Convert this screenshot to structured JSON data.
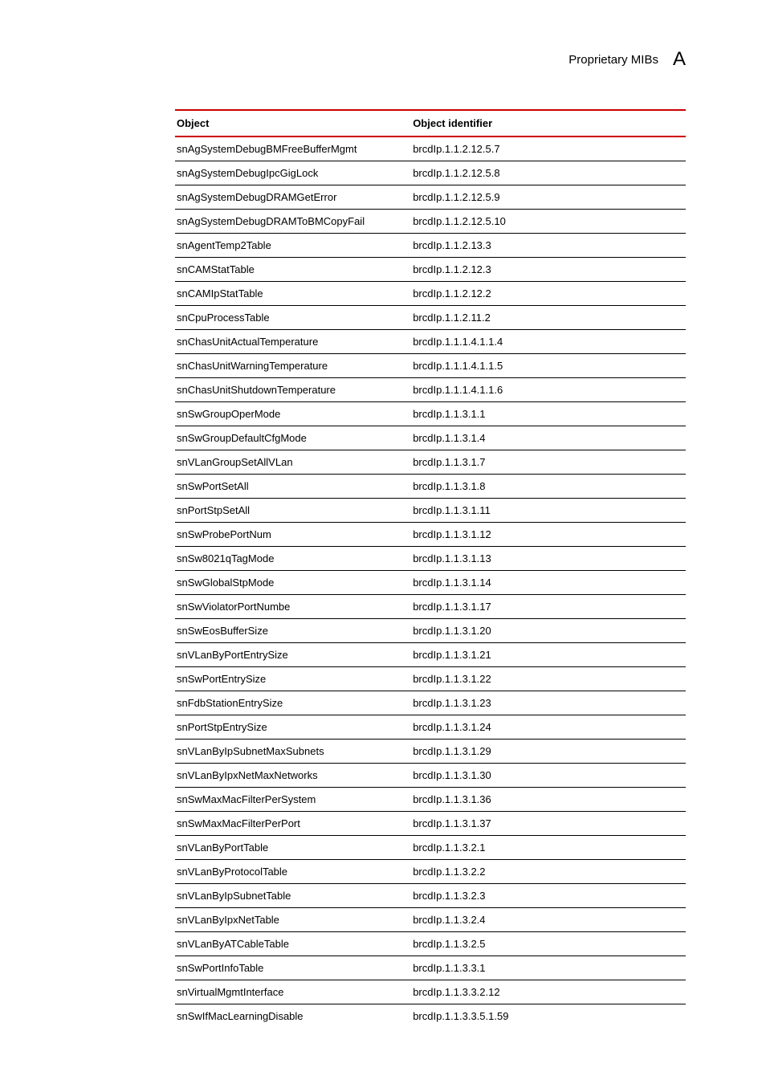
{
  "header": {
    "title": "Proprietary MIBs",
    "badge": "A"
  },
  "table": {
    "columns": [
      "Object",
      "Object identifier"
    ],
    "rows": [
      {
        "object": "snAgSystemDebugBMFreeBufferMgmt",
        "oid": "brcdIp.1.1.2.12.5.7"
      },
      {
        "object": "snAgSystemDebugIpcGigLock",
        "oid": "brcdIp.1.1.2.12.5.8"
      },
      {
        "object": "snAgSystemDebugDRAMGetError",
        "oid": "brcdIp.1.1.2.12.5.9"
      },
      {
        "object": "snAgSystemDebugDRAMToBMCopyFail",
        "oid": "brcdIp.1.1.2.12.5.10"
      },
      {
        "object": "snAgentTemp2Table",
        "oid": "brcdIp.1.1.2.13.3"
      },
      {
        "object": "snCAMStatTable",
        "oid": "brcdIp.1.1.2.12.3"
      },
      {
        "object": "snCAMIpStatTable",
        "oid": "brcdIp.1.1.2.12.2"
      },
      {
        "object": "snCpuProcessTable",
        "oid": "brcdIp.1.1.2.11.2"
      },
      {
        "object": "snChasUnitActualTemperature",
        "oid": "brcdIp.1.1.1.4.1.1.4"
      },
      {
        "object": "snChasUnitWarningTemperature",
        "oid": "brcdIp.1.1.1.4.1.1.5"
      },
      {
        "object": "snChasUnitShutdownTemperature",
        "oid": "brcdIp.1.1.1.4.1.1.6"
      },
      {
        "object": "snSwGroupOperMode",
        "oid": "brcdIp.1.1.3.1.1"
      },
      {
        "object": "snSwGroupDefaultCfgMode",
        "oid": "brcdIp.1.1.3.1.4"
      },
      {
        "object": "snVLanGroupSetAllVLan",
        "oid": "brcdIp.1.1.3.1.7"
      },
      {
        "object": "snSwPortSetAll",
        "oid": "brcdIp.1.1.3.1.8"
      },
      {
        "object": "snPortStpSetAll",
        "oid": "brcdIp.1.1.3.1.11"
      },
      {
        "object": "snSwProbePortNum",
        "oid": "brcdIp.1.1.3.1.12"
      },
      {
        "object": "snSw8021qTagMode",
        "oid": "brcdIp.1.1.3.1.13"
      },
      {
        "object": "snSwGlobalStpMode",
        "oid": "brcdIp.1.1.3.1.14"
      },
      {
        "object": "snSwViolatorPortNumbe",
        "oid": "brcdIp.1.1.3.1.17"
      },
      {
        "object": "snSwEosBufferSize",
        "oid": "brcdIp.1.1.3.1.20"
      },
      {
        "object": "snVLanByPortEntrySize",
        "oid": "brcdIp.1.1.3.1.21"
      },
      {
        "object": "snSwPortEntrySize",
        "oid": "brcdIp.1.1.3.1.22"
      },
      {
        "object": "snFdbStationEntrySize",
        "oid": "brcdIp.1.1.3.1.23"
      },
      {
        "object": "snPortStpEntrySize",
        "oid": "brcdIp.1.1.3.1.24"
      },
      {
        "object": "snVLanByIpSubnetMaxSubnets",
        "oid": "brcdIp.1.1.3.1.29"
      },
      {
        "object": "snVLanByIpxNetMaxNetworks",
        "oid": "brcdIp.1.1.3.1.30"
      },
      {
        "object": "snSwMaxMacFilterPerSystem",
        "oid": "brcdIp.1.1.3.1.36"
      },
      {
        "object": "snSwMaxMacFilterPerPort",
        "oid": "brcdIp.1.1.3.1.37"
      },
      {
        "object": "snVLanByPortTable",
        "oid": "brcdIp.1.1.3.2.1"
      },
      {
        "object": "snVLanByProtocolTable",
        "oid": "brcdIp.1.1.3.2.2"
      },
      {
        "object": "snVLanByIpSubnetTable",
        "oid": "brcdIp.1.1.3.2.3"
      },
      {
        "object": "snVLanByIpxNetTable",
        "oid": "brcdIp.1.1.3.2.4"
      },
      {
        "object": "snVLanByATCableTable",
        "oid": "brcdIp.1.1.3.2.5"
      },
      {
        "object": "snSwPortInfoTable",
        "oid": "brcdIp.1.1.3.3.1"
      },
      {
        "object": "snVirtualMgmtInterface",
        "oid": "brcdIp.1.1.3.3.2.12"
      },
      {
        "object": "snSwIfMacLearningDisable",
        "oid": "brcdIp.1.1.3.3.5.1.59"
      }
    ]
  }
}
